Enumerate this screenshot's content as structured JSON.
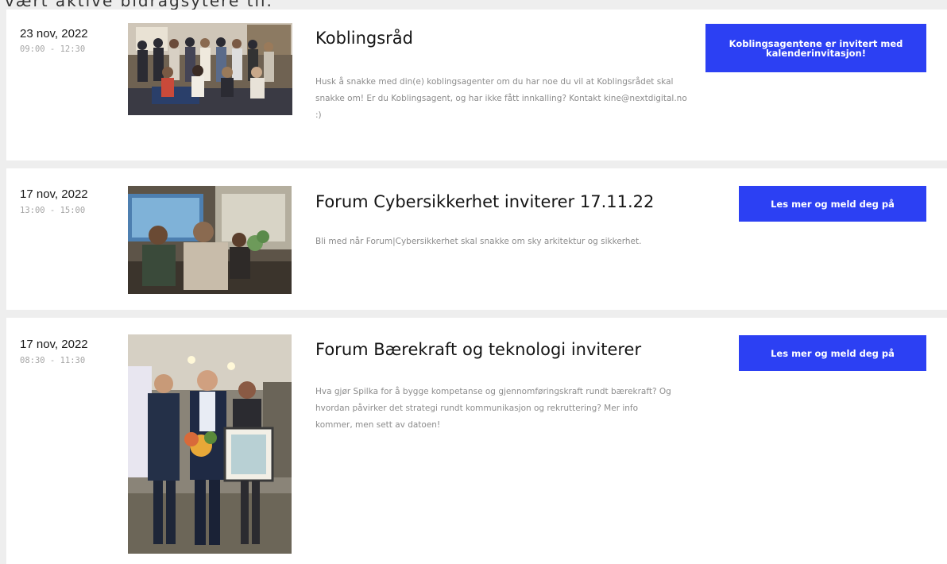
{
  "page": {
    "intro_fragment": "vært aktive bidragsytere til."
  },
  "events": [
    {
      "date": "23 nov, 2022",
      "time": "09:00 - 12:30",
      "title": "Koblingsråd",
      "description": "Husk å snakke med din(e) koblingsagenter om du har noe du vil at Koblingsrådet skal snakke om! Er du Koblingsagent, og har ikke fått innkalling? Kontakt kine@nextdigital.no :)",
      "cta_label": "Koblingsagentene er invitert med kalenderinvitasjon!",
      "photo": "group-photo"
    },
    {
      "date": "17 nov, 2022",
      "time": "13:00 - 15:00",
      "title": "Forum Cybersikkerhet inviterer 17.11.22",
      "description": "Bli med når Forum|Cybersikkerhet skal snakke om sky arkitektur og sikkerhet.",
      "cta_label": "Les mer og meld deg på",
      "photo": "meeting-room-photo"
    },
    {
      "date": "17 nov, 2022",
      "time": "08:30 - 11:30",
      "title": "Forum Bærekraft og teknologi inviterer",
      "description": "Hva gjør Spilka for å bygge kompetanse og gjennomføringskraft rundt bærekraft? Og hvordan påvirker det strategi rundt kommunikasjon og rekruttering? Mer info kommer, men sett av datoen!",
      "cta_label": "Les mer og meld deg på",
      "photo": "award-photo"
    }
  ],
  "colors": {
    "accent": "#2c40f3",
    "background": "#eeeeee",
    "card": "#ffffff"
  }
}
